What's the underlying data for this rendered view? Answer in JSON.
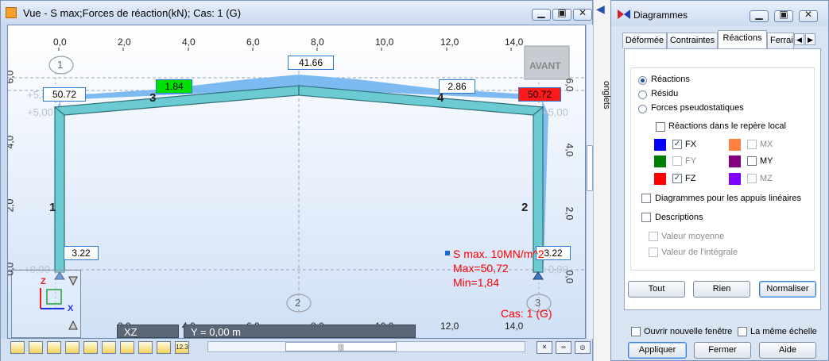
{
  "view_window": {
    "title": "Vue - S max;Forces de réaction(kN); Cas: 1 (G)",
    "window_buttons": [
      "minimize",
      "restore",
      "close"
    ],
    "axis_top_ticks": [
      "0,0",
      "2,0",
      "4,0",
      "6,0",
      "8,0",
      "10,0",
      "12,0",
      "14,0"
    ],
    "axis_bottom_ticks": [
      "0,0",
      "2,0",
      "4,0",
      "6,0",
      "8,0",
      "10,0",
      "12,0",
      "14,0"
    ],
    "axis_left_ticks": [
      "6,0",
      "4,0",
      "2,0",
      "0,0"
    ],
    "axis_right_ticks": [
      "6,0",
      "4,0",
      "2,0",
      "0,0"
    ],
    "node_labels": [
      "1",
      "2",
      "3"
    ],
    "bar_labels": [
      "1",
      "2",
      "3",
      "4"
    ],
    "reaction_labels": [
      "41.66",
      "1.84",
      "2.86",
      "50.72",
      "50.72",
      "3.22",
      "3.22"
    ],
    "faded_labels": [
      "+5,80",
      "+5,00",
      "+0,00",
      "+0,00",
      "+5,00"
    ],
    "avant_label": "AVANT",
    "legend": {
      "title": "S max. 10MN/m^2",
      "max": "Max=50,72",
      "min": "Min=1,84",
      "case": "Cas: 1 (G)"
    },
    "triad_labels": {
      "z": "Z",
      "x": "X"
    },
    "status": {
      "plane": "XZ",
      "coord": "Y = 0,00 m"
    },
    "toolbar_icons": [
      "node-icon",
      "frame-icon",
      "structure-icon",
      "support-icon",
      "load-icon",
      "member-icon",
      "dimension-icon",
      "section-icon",
      "rect-icon",
      "scale-icon"
    ],
    "toolbar_texts": [
      "",
      "",
      "",
      "",
      "",
      "",
      "",
      "",
      "",
      "12.3"
    ],
    "colors": {
      "member": "#6ccad3",
      "diagram": "#6fb3f0",
      "red": "#ff0000",
      "green": "#00ff00"
    }
  },
  "onglets": {
    "label": "onglets"
  },
  "diagram_panel": {
    "title": "Diagrammes",
    "tabs": [
      "Déformée",
      "Contraintes",
      "Réactions",
      "Ferrail"
    ],
    "active_tab": "Réactions",
    "radio_options": [
      {
        "label": "Réactions",
        "selected": true
      },
      {
        "label": "Résidu",
        "selected": false
      },
      {
        "label": "Forces pseudostatiques",
        "selected": false
      }
    ],
    "local_frame": {
      "label": "Réactions dans le repère local",
      "checked": false
    },
    "components": [
      {
        "label": "FX",
        "color": "#0000ff",
        "checked": true,
        "enabled": true
      },
      {
        "label": "MX",
        "color": "#ff8040",
        "checked": false,
        "enabled": false
      },
      {
        "label": "FY",
        "color": "#008000",
        "checked": false,
        "enabled": false
      },
      {
        "label": "MY",
        "color": "#800080",
        "checked": false,
        "enabled": true
      },
      {
        "label": "FZ",
        "color": "#ff0000",
        "checked": true,
        "enabled": true
      },
      {
        "label": "MZ",
        "color": "#8000ff",
        "checked": false,
        "enabled": false
      }
    ],
    "linear_supports": {
      "label": "Diagrammes pour les appuis linéaires",
      "checked": false
    },
    "descriptions": {
      "label": "Descriptions",
      "checked": false
    },
    "mean_value": {
      "label": "Valeur moyenne",
      "checked": false
    },
    "integral_value": {
      "label": "Valeur de l'intégrale",
      "checked": false
    },
    "buttons": {
      "all": "Tout",
      "none": "Rien",
      "normalize": "Normaliser"
    },
    "new_window": {
      "label": "Ouvrir nouvelle fenêtre",
      "checked": false
    },
    "same_scale": {
      "label": "La même échelle",
      "checked": false
    },
    "footer_buttons": {
      "apply": "Appliquer",
      "close": "Fermer",
      "help": "Aide"
    }
  }
}
